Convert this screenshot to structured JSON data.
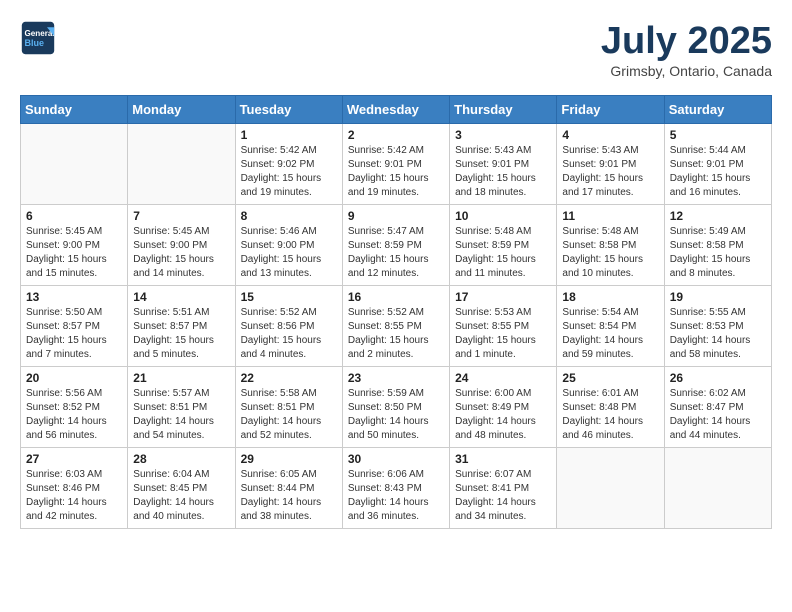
{
  "header": {
    "logo_line1": "General",
    "logo_line2": "Blue",
    "month_title": "July 2025",
    "location": "Grimsby, Ontario, Canada"
  },
  "days_of_week": [
    "Sunday",
    "Monday",
    "Tuesday",
    "Wednesday",
    "Thursday",
    "Friday",
    "Saturday"
  ],
  "weeks": [
    [
      {
        "day": "",
        "detail": ""
      },
      {
        "day": "",
        "detail": ""
      },
      {
        "day": "1",
        "detail": "Sunrise: 5:42 AM\nSunset: 9:02 PM\nDaylight: 15 hours and 19 minutes."
      },
      {
        "day": "2",
        "detail": "Sunrise: 5:42 AM\nSunset: 9:01 PM\nDaylight: 15 hours and 19 minutes."
      },
      {
        "day": "3",
        "detail": "Sunrise: 5:43 AM\nSunset: 9:01 PM\nDaylight: 15 hours and 18 minutes."
      },
      {
        "day": "4",
        "detail": "Sunrise: 5:43 AM\nSunset: 9:01 PM\nDaylight: 15 hours and 17 minutes."
      },
      {
        "day": "5",
        "detail": "Sunrise: 5:44 AM\nSunset: 9:01 PM\nDaylight: 15 hours and 16 minutes."
      }
    ],
    [
      {
        "day": "6",
        "detail": "Sunrise: 5:45 AM\nSunset: 9:00 PM\nDaylight: 15 hours and 15 minutes."
      },
      {
        "day": "7",
        "detail": "Sunrise: 5:45 AM\nSunset: 9:00 PM\nDaylight: 15 hours and 14 minutes."
      },
      {
        "day": "8",
        "detail": "Sunrise: 5:46 AM\nSunset: 9:00 PM\nDaylight: 15 hours and 13 minutes."
      },
      {
        "day": "9",
        "detail": "Sunrise: 5:47 AM\nSunset: 8:59 PM\nDaylight: 15 hours and 12 minutes."
      },
      {
        "day": "10",
        "detail": "Sunrise: 5:48 AM\nSunset: 8:59 PM\nDaylight: 15 hours and 11 minutes."
      },
      {
        "day": "11",
        "detail": "Sunrise: 5:48 AM\nSunset: 8:58 PM\nDaylight: 15 hours and 10 minutes."
      },
      {
        "day": "12",
        "detail": "Sunrise: 5:49 AM\nSunset: 8:58 PM\nDaylight: 15 hours and 8 minutes."
      }
    ],
    [
      {
        "day": "13",
        "detail": "Sunrise: 5:50 AM\nSunset: 8:57 PM\nDaylight: 15 hours and 7 minutes."
      },
      {
        "day": "14",
        "detail": "Sunrise: 5:51 AM\nSunset: 8:57 PM\nDaylight: 15 hours and 5 minutes."
      },
      {
        "day": "15",
        "detail": "Sunrise: 5:52 AM\nSunset: 8:56 PM\nDaylight: 15 hours and 4 minutes."
      },
      {
        "day": "16",
        "detail": "Sunrise: 5:52 AM\nSunset: 8:55 PM\nDaylight: 15 hours and 2 minutes."
      },
      {
        "day": "17",
        "detail": "Sunrise: 5:53 AM\nSunset: 8:55 PM\nDaylight: 15 hours and 1 minute."
      },
      {
        "day": "18",
        "detail": "Sunrise: 5:54 AM\nSunset: 8:54 PM\nDaylight: 14 hours and 59 minutes."
      },
      {
        "day": "19",
        "detail": "Sunrise: 5:55 AM\nSunset: 8:53 PM\nDaylight: 14 hours and 58 minutes."
      }
    ],
    [
      {
        "day": "20",
        "detail": "Sunrise: 5:56 AM\nSunset: 8:52 PM\nDaylight: 14 hours and 56 minutes."
      },
      {
        "day": "21",
        "detail": "Sunrise: 5:57 AM\nSunset: 8:51 PM\nDaylight: 14 hours and 54 minutes."
      },
      {
        "day": "22",
        "detail": "Sunrise: 5:58 AM\nSunset: 8:51 PM\nDaylight: 14 hours and 52 minutes."
      },
      {
        "day": "23",
        "detail": "Sunrise: 5:59 AM\nSunset: 8:50 PM\nDaylight: 14 hours and 50 minutes."
      },
      {
        "day": "24",
        "detail": "Sunrise: 6:00 AM\nSunset: 8:49 PM\nDaylight: 14 hours and 48 minutes."
      },
      {
        "day": "25",
        "detail": "Sunrise: 6:01 AM\nSunset: 8:48 PM\nDaylight: 14 hours and 46 minutes."
      },
      {
        "day": "26",
        "detail": "Sunrise: 6:02 AM\nSunset: 8:47 PM\nDaylight: 14 hours and 44 minutes."
      }
    ],
    [
      {
        "day": "27",
        "detail": "Sunrise: 6:03 AM\nSunset: 8:46 PM\nDaylight: 14 hours and 42 minutes."
      },
      {
        "day": "28",
        "detail": "Sunrise: 6:04 AM\nSunset: 8:45 PM\nDaylight: 14 hours and 40 minutes."
      },
      {
        "day": "29",
        "detail": "Sunrise: 6:05 AM\nSunset: 8:44 PM\nDaylight: 14 hours and 38 minutes."
      },
      {
        "day": "30",
        "detail": "Sunrise: 6:06 AM\nSunset: 8:43 PM\nDaylight: 14 hours and 36 minutes."
      },
      {
        "day": "31",
        "detail": "Sunrise: 6:07 AM\nSunset: 8:41 PM\nDaylight: 14 hours and 34 minutes."
      },
      {
        "day": "",
        "detail": ""
      },
      {
        "day": "",
        "detail": ""
      }
    ]
  ]
}
